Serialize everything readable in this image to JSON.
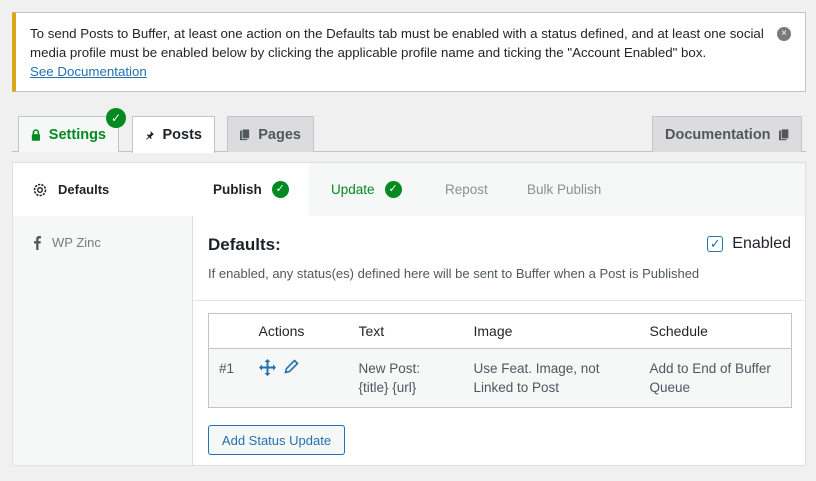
{
  "notice": {
    "text": "To send Posts to Buffer, at least one action on the Defaults tab must be enabled with a status defined, and at least one social media profile must be enabled below by clicking the applicable profile name and ticking the \"Account Enabled\" box.",
    "link": "See Documentation",
    "dismiss_icon": "×"
  },
  "top_tabs": {
    "settings": "Settings",
    "posts": "Posts",
    "pages": "Pages",
    "documentation": "Documentation"
  },
  "sidebar": {
    "items": [
      {
        "label": "Defaults",
        "icon": "gear-icon"
      },
      {
        "label": "WP Zinc",
        "icon": "facebook-icon"
      }
    ]
  },
  "sub_tabs": {
    "publish": "Publish",
    "update": "Update",
    "repost": "Repost",
    "bulk_publish": "Bulk Publish"
  },
  "section": {
    "title": "Defaults:",
    "enabled_label": "Enabled",
    "description": "If enabled, any status(es) defined here will be sent to Buffer when a Post is Published"
  },
  "table": {
    "headers": [
      "",
      "Actions",
      "Text",
      "Image",
      "Schedule"
    ],
    "rows": [
      {
        "num": "#1",
        "text": "New Post: {title} {url}",
        "image": "Use Feat. Image, not Linked to Post",
        "schedule": "Add to End of Buffer Queue"
      }
    ]
  },
  "add_button": "Add Status Update",
  "colors": {
    "accent": "#2271b1",
    "success": "#008a20",
    "warning": "#dba617"
  }
}
